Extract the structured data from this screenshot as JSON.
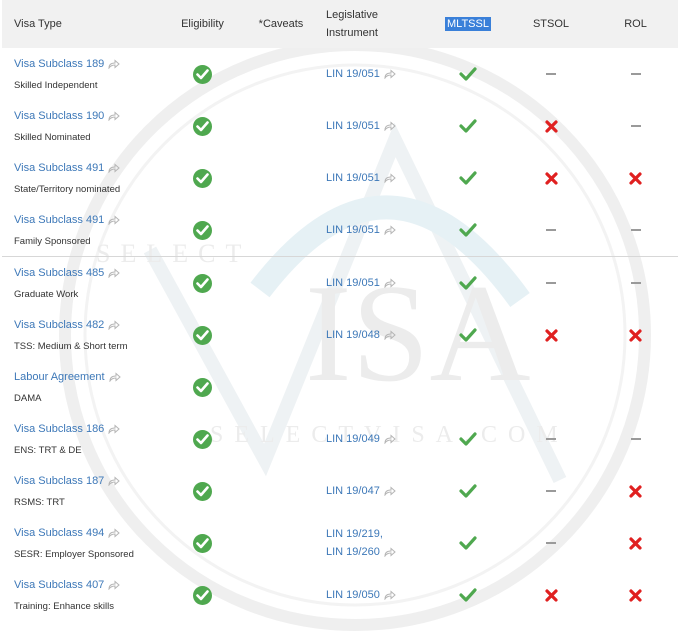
{
  "watermark": {
    "brand_top": "SELECT",
    "brand_logo": "ISA",
    "brand_url": "SELECTVISA.COM"
  },
  "header": {
    "visa_type": "Visa Type",
    "eligibility": "Eligibility",
    "caveats": "*Caveats",
    "legislative_line1": "Legislative",
    "legislative_line2": "Instrument",
    "mltssl": "MLTSSL",
    "stsol": "STSOL",
    "rol": "ROL"
  },
  "rows": [
    {
      "visa": "Visa Subclass 189",
      "sub": "Skilled Independent",
      "lin": [
        "LIN 19/051"
      ],
      "eligible": true,
      "mltssl": "tick",
      "stsol": "dash",
      "rol": "dash"
    },
    {
      "visa": "Visa Subclass 190",
      "sub": "Skilled Nominated",
      "lin": [
        "LIN 19/051"
      ],
      "eligible": true,
      "mltssl": "tick",
      "stsol": "cross",
      "rol": "dash"
    },
    {
      "visa": "Visa Subclass 491",
      "sub": "State/Territory nominated",
      "lin": [
        "LIN 19/051"
      ],
      "eligible": true,
      "mltssl": "tick",
      "stsol": "cross",
      "rol": "cross"
    },
    {
      "visa": "Visa Subclass 491",
      "sub": "Family Sponsored",
      "lin": [
        "LIN 19/051"
      ],
      "eligible": true,
      "mltssl": "tick",
      "stsol": "dash",
      "rol": "dash"
    },
    {
      "visa": "Visa Subclass 485",
      "sub": "Graduate Work",
      "lin": [
        "LIN 19/051"
      ],
      "eligible": true,
      "mltssl": "tick",
      "stsol": "dash",
      "rol": "dash"
    },
    {
      "visa": "Visa Subclass 482",
      "sub": "TSS: Medium & Short term",
      "lin": [
        "LIN 19/048"
      ],
      "eligible": true,
      "mltssl": "tick",
      "stsol": "cross",
      "rol": "cross"
    },
    {
      "visa": "Labour Agreement",
      "sub": "DAMA",
      "lin": [],
      "eligible": true,
      "mltssl": "none",
      "stsol": "none",
      "rol": "none"
    },
    {
      "visa": "Visa Subclass 186",
      "sub": "ENS: TRT & DE",
      "lin": [
        "LIN 19/049"
      ],
      "eligible": true,
      "mltssl": "tick",
      "stsol": "dash",
      "rol": "dash"
    },
    {
      "visa": "Visa Subclass 187",
      "sub": "RSMS: TRT",
      "lin": [
        "LIN 19/047"
      ],
      "eligible": true,
      "mltssl": "tick",
      "stsol": "dash",
      "rol": "cross"
    },
    {
      "visa": "Visa Subclass 494",
      "sub": "SESR: Employer Sponsored",
      "lin": [
        "LIN 19/219,",
        "LIN 19/260"
      ],
      "eligible": true,
      "mltssl": "tick",
      "stsol": "dash",
      "rol": "cross"
    },
    {
      "visa": "Visa Subclass 407",
      "sub": "Training: Enhance skills",
      "lin": [
        "LIN 19/050"
      ],
      "eligible": true,
      "mltssl": "tick",
      "stsol": "cross",
      "rol": "cross"
    }
  ],
  "colors": {
    "link": "#3d78b8",
    "green": "#4fa84f",
    "red": "#e02020",
    "dash": "#9a9a9a",
    "mltssl_highlight": "#3a80d9",
    "header_bg": "#f1f1f1"
  }
}
